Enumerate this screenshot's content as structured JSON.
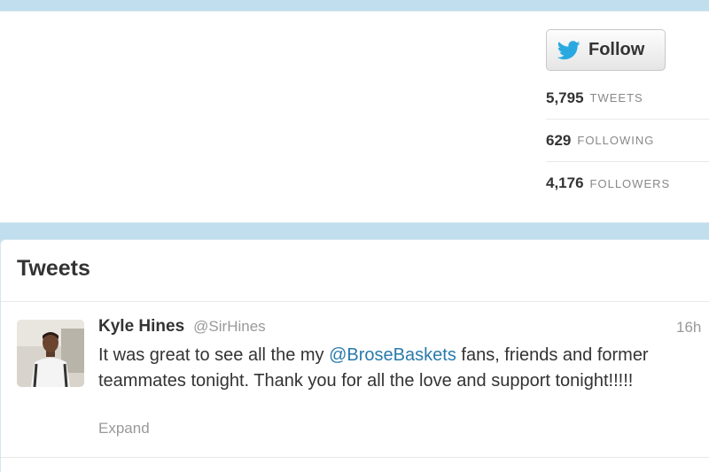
{
  "profile": {
    "follow_label": "Follow",
    "stats": [
      {
        "count": "5,795",
        "label": "TWEETS"
      },
      {
        "count": "629",
        "label": "FOLLOWING"
      },
      {
        "count": "4,176",
        "label": "FOLLOWERS"
      }
    ]
  },
  "stream": {
    "title": "Tweets",
    "tweets": [
      {
        "fullname": "Kyle Hines",
        "username": "@SirHines",
        "time": "16h",
        "text_before": "It was great to see all the my ",
        "mention": "@BroseBaskets",
        "text_after": " fans, friends and former teammates tonight. Thank you for all the love and support tonight!!!!!",
        "expand_label": "Expand"
      }
    ]
  },
  "colors": {
    "page_background": "#c0deed",
    "link": "#2a7aab",
    "twitter_bird": "#2aa9e0",
    "muted_text": "#999999"
  },
  "icons": [
    "twitter-bird-icon"
  ]
}
